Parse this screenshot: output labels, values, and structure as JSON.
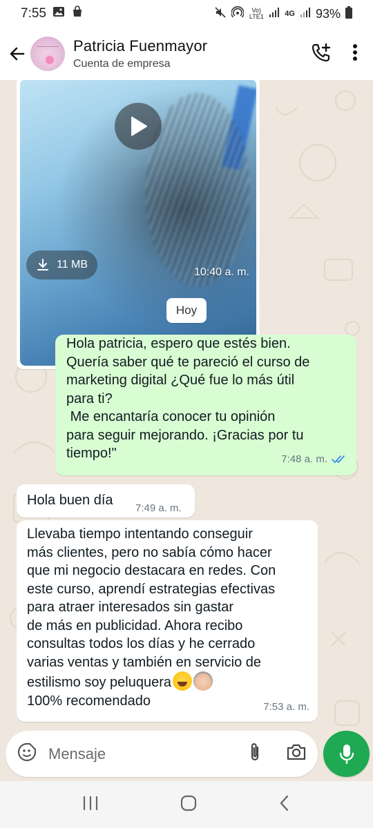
{
  "status_bar": {
    "time": "7:55",
    "battery": "93%",
    "network": "4G",
    "volte": "Vo) LTE1"
  },
  "header": {
    "contact_name": "Patricia Fuenmayor",
    "contact_subtitle": "Cuenta de empresa"
  },
  "video_message": {
    "size": "11 MB",
    "time": "10:40 a. m."
  },
  "day_separator": "Hoy",
  "messages": [
    {
      "direction": "out",
      "text": "Hola patricia, espero que estés bien.\nQuería saber qué te pareció el curso de\nmarketing digital ¿Qué fue lo más útil\npara ti?\n Me encantaría conocer tu opinión\npara seguir mejorando. ¡Gracias por tu\ntiempo!\"",
      "time": "7:48 a. m.",
      "status": "read"
    },
    {
      "direction": "in",
      "text": "Hola buen día",
      "time": "7:49 a. m."
    },
    {
      "direction": "in",
      "text": "Llevaba tiempo intentando conseguir\nmás clientes, pero no sabía cómo hacer\nque mi negocio destacara en redes. Con\neste curso, aprendí estrategias efectivas\npara atraer interesados sin gastar\nde más en publicidad. Ahora recibo\nconsultas todos los días y he cerrado\nvarias ventas y también en servicio de\nestilismo soy peluquera",
      "text_tail": "100% recomendado",
      "time": "7:53 a. m."
    }
  ],
  "composer": {
    "placeholder": "Mensaje"
  },
  "colors": {
    "outgoing_bubble": "#d9fdd3",
    "incoming_bubble": "#ffffff",
    "accent_green": "#1ea952",
    "read_ticks": "#3a8ee6",
    "wallpaper": "#efe7dd"
  }
}
